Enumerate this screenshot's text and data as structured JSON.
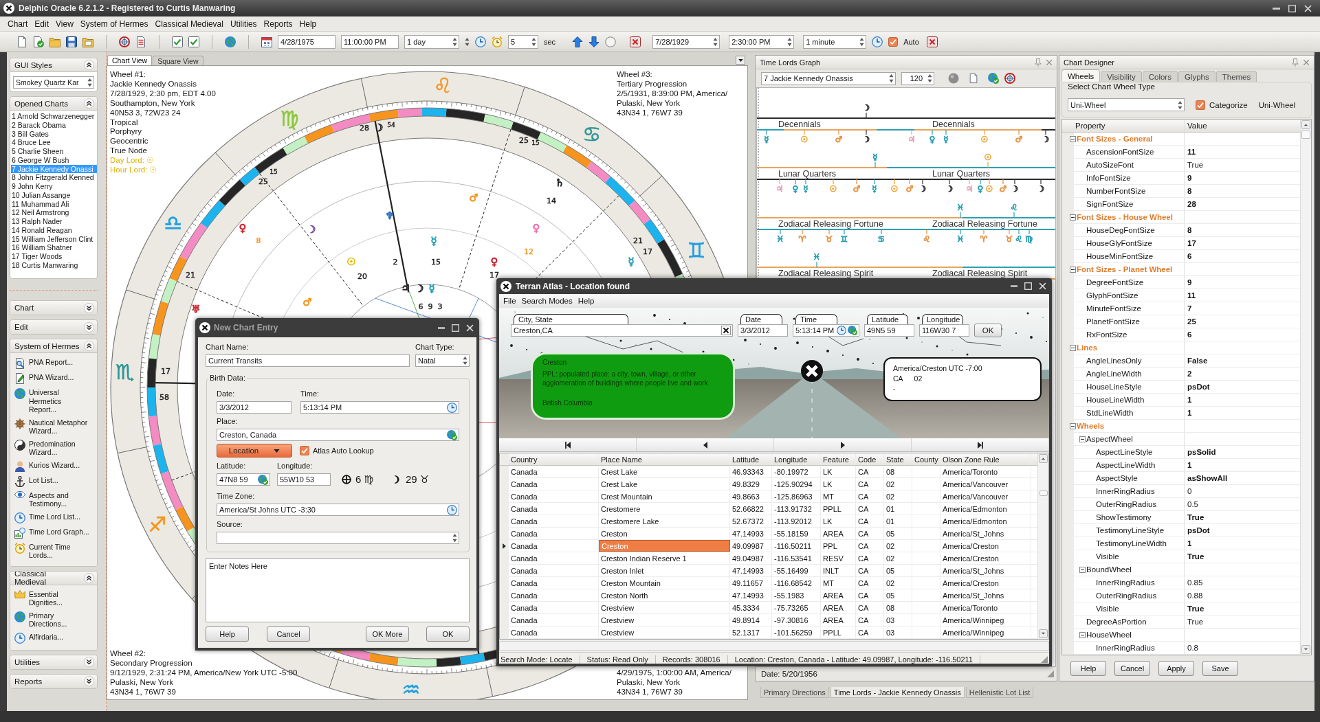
{
  "window": {
    "title": "Delphic Oracle 6.2.1.2 - Registered to Curtis Manwaring"
  },
  "menu": [
    "Chart",
    "Edit",
    "View",
    "System of Hermes",
    "Classical Medieval",
    "Utilities",
    "Reports",
    "Help"
  ],
  "toolbar": {
    "start_date": "4/28/1975",
    "start_time": "11:00:00 PM",
    "step": "1 day",
    "count": "5",
    "count_unit": "sec",
    "end_date": "7/28/1929",
    "end_time": "2:30:00 PM",
    "end_step": "1 minute",
    "auto": {
      "label": "Auto",
      "checked": true
    }
  },
  "sidebar": {
    "gui_styles": {
      "title": "GUI Styles",
      "expanded": true,
      "value": "Smokey Quartz Kar"
    },
    "opened_charts": {
      "title": "Opened Charts",
      "expanded": true,
      "items": [
        {
          "label": "1 Arnold Schwarzenegger",
          "selected": false
        },
        {
          "label": "2 Barack Obama",
          "selected": false
        },
        {
          "label": "3 Bill Gates",
          "selected": false
        },
        {
          "label": "4 Bruce Lee",
          "selected": false
        },
        {
          "label": "5 Charlie Sheen",
          "selected": false
        },
        {
          "label": "6 George W Bush",
          "selected": false
        },
        {
          "label": "7 Jackie Kennedy Onassi",
          "selected": true
        },
        {
          "label": "8 John Fitzgerald Kenned",
          "selected": false
        },
        {
          "label": "9 John Kerry",
          "selected": false
        },
        {
          "label": "10 Julian Assange",
          "selected": false
        },
        {
          "label": "11 Muhammad Ali",
          "selected": false
        },
        {
          "label": "12 Neil Armstrong",
          "selected": false
        },
        {
          "label": "13 Ralph Nader",
          "selected": false
        },
        {
          "label": "14 Ronald Reagan",
          "selected": false
        },
        {
          "label": "15 William Jefferson Clint",
          "selected": false
        },
        {
          "label": "16 William Shatner",
          "selected": false
        },
        {
          "label": "17 Tiger Woods",
          "selected": false
        },
        {
          "label": "18 Curtis Manwaring",
          "selected": false
        }
      ]
    },
    "sections": [
      {
        "title": "Chart",
        "expanded": false
      },
      {
        "title": "Edit",
        "expanded": false
      },
      {
        "title": "System of Hermes",
        "expanded": true,
        "items": [
          "PNA Report...",
          "PNA Wizard...",
          "Universal Hermetics Report...",
          "Nautical Metaphor Wizard...",
          "Predomination Wizard...",
          "Kurios Wizard...",
          "Lot List...",
          "Aspects and Testimony...",
          "Time Lord List...",
          "Time Lord Graph...",
          "Current Time Lords..."
        ]
      },
      {
        "title": "Classical Medieval",
        "expanded": true,
        "items": [
          "Essential Dignities...",
          "Primary Directions...",
          "Alfirdaria..."
        ]
      },
      {
        "title": "Utilities",
        "expanded": false
      },
      {
        "title": "Reports",
        "expanded": false
      }
    ]
  },
  "chart_view": {
    "tabs": [
      {
        "label": "Chart View",
        "selected": true
      },
      {
        "label": "Square View",
        "selected": false
      }
    ],
    "wheel_1": [
      "Wheel #1:",
      "Jackie Kennedy Onassis",
      "7/28/1929, 2:30 pm, EDT 4.00",
      "Southampton, New York",
      "40N53 3, 72W23 24",
      "Tropical",
      "Porphyry",
      "Geocentric",
      "True Node"
    ],
    "lords": [
      "Day Lord: ☉",
      "Hour Lord: ☉"
    ],
    "wheel_3": [
      "Wheel #3:",
      "Tertiary Progression",
      "2/5/1931, 8:39:00 PM, America/",
      "Pulaski, New York",
      "43N34 1, 76W7 39"
    ],
    "wheel_2": [
      "Wheel #2:",
      "Secondary Progression",
      "9/12/1929, 2:31:24 PM, America/New York UTC -5:00",
      "Pulaski, New York",
      "43N34 1, 76W7 39"
    ],
    "wheel_4": [
      "4/29/1975, 1:00:00 AM, America/",
      "Pulaski, New York",
      "43N34 1, 76W7 39"
    ],
    "signs": [
      {
        "glyph": "♊",
        "color": "#1e9fe0"
      },
      {
        "glyph": "♋",
        "color": "#2e9696"
      },
      {
        "glyph": "♌",
        "color": "#f7941d"
      },
      {
        "glyph": "♍",
        "color": "#8cc63f"
      },
      {
        "glyph": "♎",
        "color": "#1e9fe0"
      },
      {
        "glyph": "♏",
        "color": "#2e9696"
      },
      {
        "glyph": "♐",
        "color": "#f7941d"
      },
      {
        "glyph": "♒",
        "color": "#1e9fe0"
      }
    ],
    "labels": [
      {
        "kind": "degree",
        "text": "28",
        "color": "#222222"
      },
      {
        "kind": "glyph",
        "text": "☽",
        "color": "#222222"
      },
      {
        "kind": "minute",
        "text": "54",
        "color": "#222222"
      },
      {
        "kind": "degree",
        "text": "25",
        "color": "#222222"
      },
      {
        "kind": "minute",
        "text": "15",
        "color": "#222222"
      },
      {
        "kind": "minute",
        "text": "15",
        "color": "#222222"
      },
      {
        "kind": "degree",
        "text": "25",
        "color": "#222222"
      },
      {
        "kind": "glyph",
        "text": "♄",
        "color": "#222222"
      },
      {
        "kind": "glyph",
        "text": "♂",
        "color": "#f7941d"
      },
      {
        "kind": "degree",
        "text": "14",
        "color": "#222222"
      },
      {
        "kind": "glyph",
        "text": "♆",
        "color": "#2a6fc0"
      },
      {
        "kind": "glyph",
        "text": "♀",
        "color": "#c8202a"
      },
      {
        "kind": "glyph",
        "text": "☽",
        "color": "#7a4ca0"
      },
      {
        "kind": "glyph",
        "text": "♀",
        "color": "#ec6fae"
      },
      {
        "kind": "degree",
        "text": "8",
        "color": "#f7941d"
      },
      {
        "kind": "glyph",
        "text": "☿",
        "color": "#22a0b8"
      },
      {
        "kind": "degree",
        "text": "21",
        "color": "#222222"
      },
      {
        "kind": "degree",
        "text": "12",
        "color": "#f7941d"
      },
      {
        "kind": "degree",
        "text": "17",
        "color": "#222222"
      },
      {
        "kind": "glyph",
        "text": "☉",
        "color": "#e8b800"
      },
      {
        "kind": "degree",
        "text": "2",
        "color": "#222222"
      },
      {
        "kind": "degree",
        "text": "15",
        "color": "#222222"
      },
      {
        "kind": "glyph",
        "text": "♀",
        "color": "#c8202a"
      },
      {
        "kind": "glyph",
        "text": "☿",
        "color": "#22a0b8"
      },
      {
        "kind": "degree",
        "text": "21",
        "color": "#222222"
      },
      {
        "kind": "degree",
        "text": "20",
        "color": "#222222"
      },
      {
        "kind": "degree",
        "text": "17",
        "color": "#222222"
      },
      {
        "kind": "glyph",
        "text": "♃",
        "color": "#222222"
      },
      {
        "kind": "glyph",
        "text": "☽",
        "color": "#222222"
      },
      {
        "kind": "glyph",
        "text": "☿",
        "color": "#22a0b8"
      },
      {
        "kind": "glyph",
        "text": "♅",
        "color": "#c8202a"
      },
      {
        "kind": "glyph",
        "text": "♂",
        "color": "#f7941d"
      },
      {
        "kind": "degree",
        "text": "6",
        "color": "#222222"
      },
      {
        "kind": "degree",
        "text": "9",
        "color": "#222222"
      },
      {
        "kind": "degree",
        "text": "3",
        "color": "#222222"
      },
      {
        "kind": "degree",
        "text": "17",
        "color": "#222222"
      },
      {
        "kind": "degree",
        "text": "58",
        "color": "#222222"
      }
    ]
  },
  "time_lords": {
    "title": "Time Lords Graph",
    "chart": "7 Jackie Kennedy Onassis",
    "count": "120",
    "bands": [
      {
        "labels": [
          "Decennials",
          "Decennials"
        ],
        "upper": [
          {
            "glyph": "☽",
            "color": "#333333"
          }
        ],
        "markers": [
          {
            "glyph": "☿",
            "color": "#2a9fb0"
          },
          {
            "glyph": "☉",
            "color": "#f0a030"
          },
          {
            "glyph": "♂",
            "color": "#e89040"
          },
          {
            "glyph": "☽",
            "color": "#333333"
          },
          {
            "glyph": "♃",
            "color": "#e8a0b8"
          },
          {
            "glyph": "♀",
            "color": "#2a9fb0"
          },
          {
            "glyph": "☿",
            "color": "#2a9fb0"
          },
          {
            "glyph": "☉",
            "color": "#f0a030"
          },
          {
            "glyph": "♂",
            "color": "#e89040"
          },
          {
            "glyph": "☽",
            "color": "#333333"
          }
        ]
      },
      {
        "labels": [
          "Lunar Quarters",
          "Lunar Quarters"
        ],
        "upper": [
          {
            "glyph": "☿",
            "color": "#2a9fb0"
          },
          {
            "glyph": "☉",
            "color": "#f0a030"
          }
        ],
        "markers": [
          {
            "glyph": "♃",
            "color": "#e8a0b8"
          },
          {
            "glyph": "♀",
            "color": "#2a9fb0"
          },
          {
            "glyph": "☿",
            "color": "#2a9fb0"
          },
          {
            "glyph": "☉",
            "color": "#f0a030"
          },
          {
            "glyph": "♂",
            "color": "#e89040"
          },
          {
            "glyph": "☿",
            "color": "#2a9fb0"
          },
          {
            "glyph": "☉",
            "color": "#f0a030"
          },
          {
            "glyph": "♂",
            "color": "#e89040"
          },
          {
            "glyph": "☽",
            "color": "#333333"
          },
          {
            "glyph": "☽",
            "color": "#333333"
          },
          {
            "glyph": "♃",
            "color": "#e8a0b8"
          },
          {
            "glyph": "♀",
            "color": "#2a9fb0"
          },
          {
            "glyph": "☉",
            "color": "#f0a030"
          },
          {
            "glyph": "♂",
            "color": "#e89040"
          },
          {
            "glyph": "☽",
            "color": "#333333"
          },
          {
            "glyph": "☽",
            "color": "#333333"
          }
        ]
      },
      {
        "labels": [
          "Zodiacal Releasing Fortune",
          "Zodiacal Releasing Fortune"
        ],
        "upper": [
          {
            "glyph": "♓",
            "color": "#2a9fb0"
          },
          {
            "glyph": "♌",
            "color": "#2a9fb0"
          }
        ],
        "markers": [
          {
            "glyph": "♓",
            "color": "#2a9fb0"
          },
          {
            "glyph": "♈",
            "color": "#e89040"
          },
          {
            "glyph": "♉",
            "color": "#e89040"
          },
          {
            "glyph": "♊",
            "color": "#2a9fb0"
          },
          {
            "glyph": "♋",
            "color": "#2a9fb0"
          },
          {
            "glyph": "♌",
            "color": "#e89040"
          },
          {
            "glyph": "♓",
            "color": "#2a9fb0"
          },
          {
            "glyph": "♈",
            "color": "#e89040"
          },
          {
            "glyph": "♉",
            "color": "#e89040"
          },
          {
            "glyph": "♌",
            "color": "#2a9fb0"
          },
          {
            "glyph": "♍",
            "color": "#2a9fb0"
          }
        ]
      },
      {
        "labels": [
          "Zodiacal Releasing Spirit",
          "Zodiacal Releasing Spirit"
        ],
        "upper": [
          {
            "glyph": "♓",
            "color": "#2a9fb0"
          }
        ]
      }
    ],
    "status": "Date: 5/20/1956"
  },
  "chart_designer": {
    "title": "Chart Designer",
    "tabs": [
      {
        "label": "Wheels",
        "selected": true
      },
      {
        "label": "Visibility",
        "selected": false
      },
      {
        "label": "Colors",
        "selected": false
      },
      {
        "label": "Glyphs",
        "selected": false
      },
      {
        "label": "Themes",
        "selected": false
      }
    ],
    "wheel_type": {
      "legend": "Select Chart Wheel Type",
      "value": "Uni-Wheel",
      "categorize": {
        "label": "Categorize",
        "checked": true
      },
      "current": "Uni-Wheel"
    },
    "columns": [
      "Property",
      "Value"
    ],
    "properties": [
      {
        "category": "Font Sizes - General",
        "expanded": true,
        "children": [
          {
            "name": "AscensionFontSize",
            "value": "11",
            "non_default": true
          },
          {
            "name": "AutoSizeFont",
            "value": "True",
            "non_default": false
          },
          {
            "name": "InfoFontSize",
            "value": "9",
            "non_default": true
          },
          {
            "name": "NumberFontSize",
            "value": "8",
            "non_default": true
          },
          {
            "name": "SignFontSize",
            "value": "28",
            "non_default": true
          }
        ]
      },
      {
        "category": "Font Sizes - House Wheel",
        "expanded": true,
        "children": [
          {
            "name": "HouseDegFontSize",
            "value": "8",
            "non_default": true
          },
          {
            "name": "HouseGlyFontSize",
            "value": "17",
            "non_default": true
          },
          {
            "name": "HouseMinFontSize",
            "value": "6",
            "non_default": true
          }
        ]
      },
      {
        "category": "Font Sizes - Planet Wheel",
        "expanded": true,
        "children": [
          {
            "name": "DegreeFontSize",
            "value": "9",
            "non_default": true
          },
          {
            "name": "GlyphFontSize",
            "value": "11",
            "non_default": true
          },
          {
            "name": "MinuteFontSize",
            "value": "7",
            "non_default": true
          },
          {
            "name": "PlanetFontSize",
            "value": "25",
            "non_default": true
          },
          {
            "name": "RxFontSize",
            "value": "6",
            "non_default": true
          }
        ]
      },
      {
        "category": "Lines",
        "expanded": true,
        "children": [
          {
            "name": "AngleLinesOnly",
            "value": "False",
            "non_default": true
          },
          {
            "name": "AngleLineWidth",
            "value": "2",
            "non_default": true
          },
          {
            "name": "HouseLineStyle",
            "value": "psDot",
            "non_default": true
          },
          {
            "name": "HouseLineWidth",
            "value": "1",
            "non_default": true
          },
          {
            "name": "StdLineWidth",
            "value": "1",
            "non_default": true
          }
        ]
      },
      {
        "category": "Wheels",
        "expanded": true,
        "children": [
          {
            "name": "AspectWheel",
            "expanded": true,
            "children": [
              {
                "name": "AspectLineStyle",
                "value": "psSolid",
                "non_default": true
              },
              {
                "name": "AspectLineWidth",
                "value": "1",
                "non_default": true
              },
              {
                "name": "AspectStyle",
                "value": "asShowAll",
                "non_default": true
              },
              {
                "name": "InnerRingRadius",
                "value": "0",
                "non_default": false
              },
              {
                "name": "OuterRingRadius",
                "value": "0.5",
                "non_default": false
              },
              {
                "name": "ShowTestimony",
                "value": "True",
                "non_default": true
              },
              {
                "name": "TestimonyLineStyle",
                "value": "psDot",
                "non_default": true
              },
              {
                "name": "TestimonyLineWidth",
                "value": "1",
                "non_default": true
              },
              {
                "name": "Visible",
                "value": "True",
                "non_default": true
              }
            ]
          },
          {
            "name": "BoundWheel",
            "expanded": true,
            "children": [
              {
                "name": "InnerRingRadius",
                "value": "0.85",
                "non_default": false
              },
              {
                "name": "OuterRingRadius",
                "value": "0.88",
                "non_default": false
              },
              {
                "name": "Visible",
                "value": "True",
                "non_default": true
              }
            ]
          },
          {
            "name": "DegreeAsPortion",
            "value": "True",
            "non_default": false
          },
          {
            "name": "HouseWheel",
            "expanded": true,
            "children": [
              {
                "name": "InnerRingRadius",
                "value": "0.8",
                "non_default": false
              }
            ]
          }
        ]
      }
    ],
    "buttons": [
      "Help",
      "Cancel",
      "Apply",
      "Save"
    ]
  },
  "document_tabs": [
    {
      "label": "Primary Directions",
      "selected": false
    },
    {
      "label": "Time Lords - Jackie Kennedy Onassis",
      "selected": true
    },
    {
      "label": "Hellenistic Lot List",
      "selected": false
    }
  ],
  "new_chart_dialog": {
    "title": "New Chart Entry",
    "chart_name": {
      "label": "Chart Name:",
      "value": "Current Transits"
    },
    "chart_type": {
      "label": "Chart Type:",
      "value": "Natal"
    },
    "birth_data": {
      "legend": "Birth Data:",
      "date": {
        "label": "Date:",
        "value": "3/3/2012"
      },
      "time": {
        "label": "Time:",
        "value": "5:13:14 PM"
      },
      "place": {
        "label": "Place:",
        "value": "Creston, Canada"
      },
      "location_button": "Location",
      "atlas_auto_lookup": {
        "label": "Atlas Auto Lookup",
        "checked": true
      },
      "latitude": {
        "label": "Latitude:",
        "value": "47N8 59"
      },
      "longitude": {
        "label": "Longitude:",
        "value": "55W10 53"
      },
      "positions": [
        "6 ♍",
        "29 ♉"
      ],
      "time_zone": {
        "label": "Time Zone:",
        "value": "America/St Johns UTC -3:30"
      },
      "source": {
        "label": "Source:"
      }
    },
    "notes": "Enter Notes Here",
    "buttons": [
      "Help",
      "Cancel",
      "OK More",
      "OK"
    ]
  },
  "terran_atlas": {
    "title": "Terran Atlas - Location found",
    "menu": [
      "File",
      "Search Modes",
      "Help"
    ],
    "search": [
      {
        "label": "City, State",
        "value": "Creston,CA"
      },
      {
        "label": "Date",
        "value": "3/3/2012"
      },
      {
        "label": "Time",
        "value": "5:13:14 PM"
      },
      {
        "label": "Latitude",
        "value": "49N5 59"
      },
      {
        "label": "Longitude",
        "value": "116W30 7"
      }
    ],
    "ok": "OK",
    "place_sign": {
      "name": "Creston",
      "description": "PPL: populated place: a city, town, village, or other agglomeration of buildings where people live and work",
      "region": "British Columbia"
    },
    "zone_sign": {
      "zone": "America/Creston UTC -7:00",
      "code": "CA",
      "state": "02",
      "county": "-"
    },
    "table": {
      "columns": [
        "Country",
        "Place Name",
        "Latitude",
        "Longitude",
        "Feature",
        "Code",
        "State",
        "County",
        "Olson Zone Rule"
      ],
      "rows": [
        {
          "country": "Canada",
          "place_name": "Crest Lake",
          "latitude": "46.93343",
          "longitude": "-80.19972",
          "feature": "LK",
          "code": "CA",
          "state": "08",
          "olson_zone_rule": "America/Toronto",
          "selected": false
        },
        {
          "country": "Canada",
          "place_name": "Crest Lake",
          "latitude": "49.8329",
          "longitude": "-125.90294",
          "feature": "LK",
          "code": "CA",
          "state": "02",
          "olson_zone_rule": "America/Vancouver",
          "selected": false
        },
        {
          "country": "Canada",
          "place_name": "Crest Mountain",
          "latitude": "49.8663",
          "longitude": "-125.86963",
          "feature": "MT",
          "code": "CA",
          "state": "02",
          "olson_zone_rule": "America/Vancouver",
          "selected": false
        },
        {
          "country": "Canada",
          "place_name": "Crestomere",
          "latitude": "52.66822",
          "longitude": "-113.91732",
          "feature": "PPLL",
          "code": "CA",
          "state": "01",
          "olson_zone_rule": "America/Edmonton",
          "selected": false
        },
        {
          "country": "Canada",
          "place_name": "Crestomere Lake",
          "latitude": "52.67372",
          "longitude": "-113.92012",
          "feature": "LK",
          "code": "CA",
          "state": "01",
          "olson_zone_rule": "America/Edmonton",
          "selected": false
        },
        {
          "country": "Canada",
          "place_name": "Creston",
          "latitude": "47.14993",
          "longitude": "-55.18159",
          "feature": "AREA",
          "code": "CA",
          "state": "05",
          "olson_zone_rule": "America/St_Johns",
          "selected": false
        },
        {
          "country": "Canada",
          "place_name": "Creston",
          "latitude": "49.09987",
          "longitude": "-116.50211",
          "feature": "PPL",
          "code": "CA",
          "state": "02",
          "olson_zone_rule": "America/Creston",
          "selected": true
        },
        {
          "country": "Canada",
          "place_name": "Creston Indian Reserve 1",
          "latitude": "49.04987",
          "longitude": "-116.53541",
          "feature": "RESV",
          "code": "CA",
          "state": "02",
          "olson_zone_rule": "America/Creston",
          "selected": false
        },
        {
          "country": "Canada",
          "place_name": "Creston Inlet",
          "latitude": "47.14993",
          "longitude": "-55.16499",
          "feature": "INLT",
          "code": "CA",
          "state": "05",
          "olson_zone_rule": "America/St_Johns",
          "selected": false
        },
        {
          "country": "Canada",
          "place_name": "Creston Mountain",
          "latitude": "49.11657",
          "longitude": "-116.68542",
          "feature": "MT",
          "code": "CA",
          "state": "02",
          "olson_zone_rule": "America/Creston",
          "selected": false
        },
        {
          "country": "Canada",
          "place_name": "Creston North",
          "latitude": "47.14993",
          "longitude": "-55.1983",
          "feature": "AREA",
          "code": "CA",
          "state": "05",
          "olson_zone_rule": "America/St_Johns",
          "selected": false
        },
        {
          "country": "Canada",
          "place_name": "Crestview",
          "latitude": "45.3334",
          "longitude": "-75.73265",
          "feature": "AREA",
          "code": "CA",
          "state": "08",
          "olson_zone_rule": "America/Toronto",
          "selected": false
        },
        {
          "country": "Canada",
          "place_name": "Crestview",
          "latitude": "49.8914",
          "longitude": "-97.30816",
          "feature": "AREA",
          "code": "CA",
          "state": "03",
          "olson_zone_rule": "America/Winnipeg",
          "selected": false
        },
        {
          "country": "Canada",
          "place_name": "Crestview",
          "latitude": "52.1317",
          "longitude": "-101.56259",
          "feature": "PPLL",
          "code": "CA",
          "state": "03",
          "olson_zone_rule": "America/Winnipeg",
          "selected": false
        }
      ]
    },
    "status_bar": [
      "Search Mode: Locate",
      "Status: Read Only",
      "Records: 308016",
      "Location: Creston, Canada - Latitude: 49.09987, Longitude: -116.50211"
    ]
  }
}
